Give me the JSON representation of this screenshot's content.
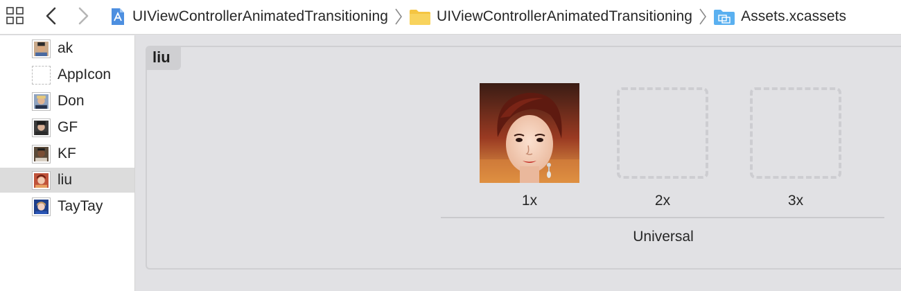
{
  "jumpbar": {
    "icons": [
      "grid-icon",
      "chevron-left-icon",
      "chevron-right-icon"
    ],
    "breadcrumbs": [
      {
        "label": "UIViewControllerAnimatedTransitioning",
        "icon": "xcode-project-icon"
      },
      {
        "label": "UIViewControllerAnimatedTransitioning",
        "icon": "folder-icon"
      },
      {
        "label": "Assets.xcassets",
        "icon": "asset-catalog-icon"
      }
    ]
  },
  "sidebar": {
    "items": [
      {
        "label": "ak",
        "thumb": "photo"
      },
      {
        "label": "AppIcon",
        "thumb": "empty"
      },
      {
        "label": "Don",
        "thumb": "photo"
      },
      {
        "label": "GF",
        "thumb": "photo"
      },
      {
        "label": "KF",
        "thumb": "photo"
      },
      {
        "label": "liu",
        "thumb": "photo",
        "selected": true
      },
      {
        "label": "TayTay",
        "thumb": "photo"
      }
    ]
  },
  "image_set": {
    "name": "liu",
    "slots": [
      {
        "scale": "1x",
        "filled": true
      },
      {
        "scale": "2x",
        "filled": false
      },
      {
        "scale": "3x",
        "filled": false
      }
    ],
    "idiom": "Universal"
  },
  "colors": {
    "background": "#e1e1e4",
    "sidebar_selected": "#dcdcdc",
    "folder_yellow": "#f5c542",
    "catalog_blue": "#5ab0f0"
  }
}
